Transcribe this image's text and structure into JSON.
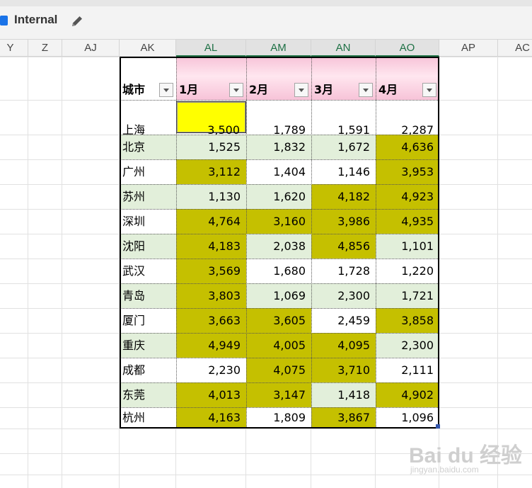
{
  "toolbar": {
    "label_text": "Internal",
    "edit_icon": "pencil-icon"
  },
  "sheet": {
    "column_letters": [
      "Y",
      "Z",
      "AJ",
      "AK",
      "AL",
      "AM",
      "AN",
      "AO",
      "AP",
      "AC"
    ],
    "selected_columns": [
      "AL",
      "AM",
      "AN",
      "AO"
    ],
    "header_gradient_color": "#f7c3d8",
    "highlight_color": "#c5c000",
    "active_cell_color": "#ffff00",
    "band_color": "#e2efda"
  },
  "table": {
    "headers": [
      "城市",
      "1月",
      "2月",
      "3月",
      "4月"
    ],
    "rows": [
      {
        "city": "上海",
        "values": [
          "3,500",
          "1,789",
          "1,591",
          "2,287"
        ],
        "hl": [
          1,
          0,
          0,
          0
        ]
      },
      {
        "city": "北京",
        "values": [
          "1,525",
          "1,832",
          "1,672",
          "4,636"
        ],
        "hl": [
          0,
          0,
          0,
          1
        ]
      },
      {
        "city": "广州",
        "values": [
          "3,112",
          "1,404",
          "1,146",
          "3,953"
        ],
        "hl": [
          1,
          0,
          0,
          1
        ]
      },
      {
        "city": "苏州",
        "values": [
          "1,130",
          "1,620",
          "4,182",
          "4,923"
        ],
        "hl": [
          0,
          0,
          1,
          1
        ]
      },
      {
        "city": "深圳",
        "values": [
          "4,764",
          "3,160",
          "3,986",
          "4,935"
        ],
        "hl": [
          1,
          1,
          1,
          1
        ]
      },
      {
        "city": "沈阳",
        "values": [
          "4,183",
          "2,038",
          "4,856",
          "1,101"
        ],
        "hl": [
          1,
          0,
          1,
          0
        ]
      },
      {
        "city": "武汉",
        "values": [
          "3,569",
          "1,680",
          "1,728",
          "1,220"
        ],
        "hl": [
          1,
          0,
          0,
          0
        ]
      },
      {
        "city": "青岛",
        "values": [
          "3,803",
          "1,069",
          "2,300",
          "1,721"
        ],
        "hl": [
          1,
          0,
          0,
          0
        ]
      },
      {
        "city": "厦门",
        "values": [
          "3,663",
          "3,605",
          "2,459",
          "3,858"
        ],
        "hl": [
          1,
          1,
          0,
          1
        ]
      },
      {
        "city": "重庆",
        "values": [
          "4,949",
          "4,005",
          "4,095",
          "2,300"
        ],
        "hl": [
          1,
          1,
          1,
          0
        ]
      },
      {
        "city": "成都",
        "values": [
          "2,230",
          "4,075",
          "3,710",
          "2,111"
        ],
        "hl": [
          0,
          1,
          1,
          0
        ]
      },
      {
        "city": "东莞",
        "values": [
          "4,013",
          "3,147",
          "1,418",
          "4,902"
        ],
        "hl": [
          1,
          1,
          0,
          1
        ]
      },
      {
        "city": "杭州",
        "values": [
          "4,163",
          "1,809",
          "3,867",
          "1,096"
        ],
        "hl": [
          1,
          0,
          1,
          0
        ]
      }
    ]
  },
  "watermark": {
    "main": "Bai du 经验",
    "sub": "jingyan.baidu.com"
  }
}
